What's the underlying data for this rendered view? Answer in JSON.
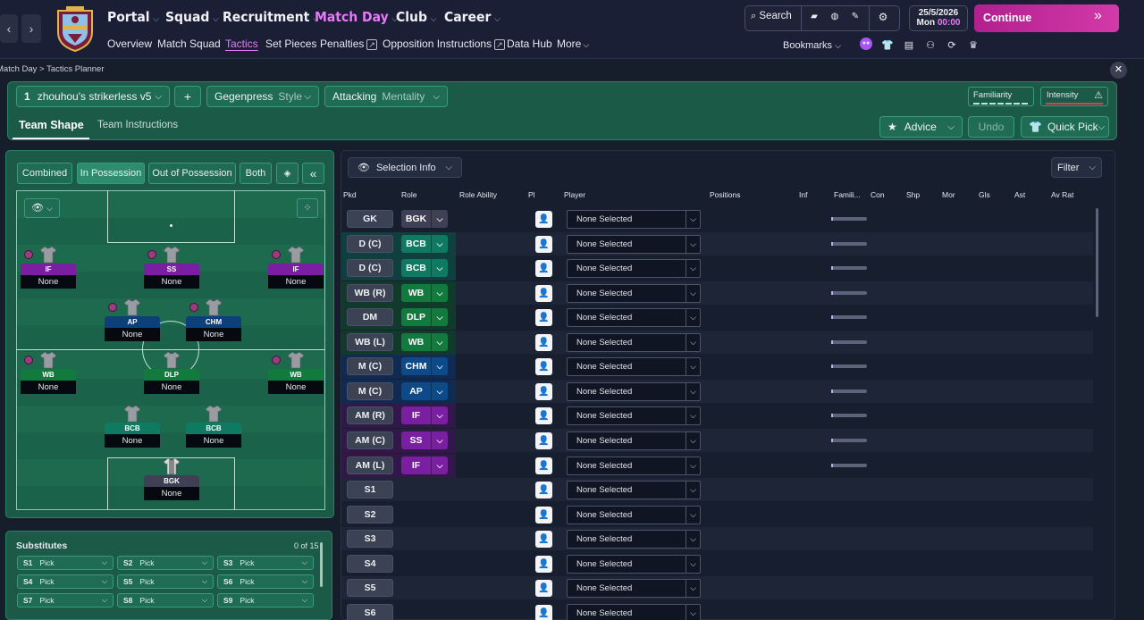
{
  "nav": {
    "main": [
      {
        "label": "Portal"
      },
      {
        "label": "Squad"
      },
      {
        "label": "Recruitment"
      },
      {
        "label": "Match Day"
      },
      {
        "label": "Club"
      },
      {
        "label": "Career"
      }
    ],
    "sub": [
      "Overview",
      "Match Squad",
      "Tactics",
      "Set Pieces",
      "Penalties",
      "Opposition Instructions",
      "Data Hub",
      "More"
    ],
    "search_label": "Search",
    "bookmarks_label": "Bookmarks",
    "date": "25/5/2026",
    "day": "Mon",
    "time": "00:00",
    "continue_label": "Continue"
  },
  "breadcrumb": {
    "parent": "Match Day",
    "current": "Tactics Planner"
  },
  "tactic": {
    "slot": "1",
    "name": "zhouhou's strikerless v5",
    "style_value": "Gegenpress",
    "style_label": "Style",
    "mentality_value": "Attacking",
    "mentality_label": "Mentality",
    "familiarity_label": "Familiarity",
    "intensity_label": "Intensity",
    "tabs": {
      "shape": "Team Shape",
      "instructions": "Team Instructions"
    },
    "advice_label": "Advice",
    "undo_label": "Undo",
    "quickpick_label": "Quick Pick"
  },
  "phase_tabs": [
    "Combined",
    "In Possession",
    "Out of Possession",
    "Both"
  ],
  "pitch_players": [
    {
      "role": "IF",
      "name": "None",
      "color": "#7b1fa2"
    },
    {
      "role": "SS",
      "name": "None",
      "color": "#7b1fa2"
    },
    {
      "role": "IF",
      "name": "None",
      "color": "#7b1fa2"
    },
    {
      "role": "AP",
      "name": "None",
      "color": "#0d3f7a"
    },
    {
      "role": "CHM",
      "name": "None",
      "color": "#0d3f7a"
    },
    {
      "role": "WB",
      "name": "None",
      "color": "#137a3e"
    },
    {
      "role": "DLP",
      "name": "None",
      "color": "#137a3e"
    },
    {
      "role": "WB",
      "name": "None",
      "color": "#137a3e"
    },
    {
      "role": "BCB",
      "name": "None",
      "color": "#0f7a62"
    },
    {
      "role": "BCB",
      "name": "None",
      "color": "#0f7a62"
    },
    {
      "role": "BGK",
      "name": "None",
      "color": "#3f3f55"
    }
  ],
  "substitutes": {
    "title": "Substitutes",
    "count": "0 of 15",
    "items": [
      {
        "slot": "S1",
        "label": "Pick"
      },
      {
        "slot": "S2",
        "label": "Pick"
      },
      {
        "slot": "S3",
        "label": "Pick"
      },
      {
        "slot": "S4",
        "label": "Pick"
      },
      {
        "slot": "S5",
        "label": "Pick"
      },
      {
        "slot": "S6",
        "label": "Pick"
      },
      {
        "slot": "S7",
        "label": "Pick"
      },
      {
        "slot": "S8",
        "label": "Pick"
      },
      {
        "slot": "S9",
        "label": "Pick"
      }
    ]
  },
  "selection": {
    "info_label": "Selection Info",
    "filter_label": "Filter",
    "columns": [
      "Pkd",
      "Role",
      "Role Ability",
      "Pl",
      "Player",
      "Positions",
      "Inf",
      "Famili...",
      "Con",
      "Shp",
      "Mor",
      "Gls",
      "Ast",
      "Av Rat"
    ],
    "rows": [
      {
        "pos": "GK",
        "role": "BGK",
        "player": "None Selected",
        "color": "#3f3f55",
        "band": "none"
      },
      {
        "pos": "D (C)",
        "role": "BCB",
        "player": "None Selected",
        "color": "#0f7a62",
        "band": "teal"
      },
      {
        "pos": "D (C)",
        "role": "BCB",
        "player": "None Selected",
        "color": "#0f7a62",
        "band": "teal"
      },
      {
        "pos": "WB (R)",
        "role": "WB",
        "player": "None Selected",
        "color": "#137a3e",
        "band": "green"
      },
      {
        "pos": "DM",
        "role": "DLP",
        "player": "None Selected",
        "color": "#137a3e",
        "band": "green"
      },
      {
        "pos": "WB (L)",
        "role": "WB",
        "player": "None Selected",
        "color": "#137a3e",
        "band": "green"
      },
      {
        "pos": "M (C)",
        "role": "CHM",
        "player": "None Selected",
        "color": "#0d4a8a",
        "band": "blue"
      },
      {
        "pos": "M (C)",
        "role": "AP",
        "player": "None Selected",
        "color": "#0d4a8a",
        "band": "blue"
      },
      {
        "pos": "AM (R)",
        "role": "IF",
        "player": "None Selected",
        "color": "#7b1fa2",
        "band": "purple"
      },
      {
        "pos": "AM (C)",
        "role": "SS",
        "player": "None Selected",
        "color": "#7b1fa2",
        "band": "purple"
      },
      {
        "pos": "AM (L)",
        "role": "IF",
        "player": "None Selected",
        "color": "#7b1fa2",
        "band": "purple"
      },
      {
        "pos": "S1",
        "role": "",
        "player": "None Selected"
      },
      {
        "pos": "S2",
        "role": "",
        "player": "None Selected"
      },
      {
        "pos": "S3",
        "role": "",
        "player": "None Selected"
      },
      {
        "pos": "S4",
        "role": "",
        "player": "None Selected"
      },
      {
        "pos": "S5",
        "role": "",
        "player": "None Selected"
      },
      {
        "pos": "S6",
        "role": "",
        "player": "None Selected"
      }
    ]
  }
}
